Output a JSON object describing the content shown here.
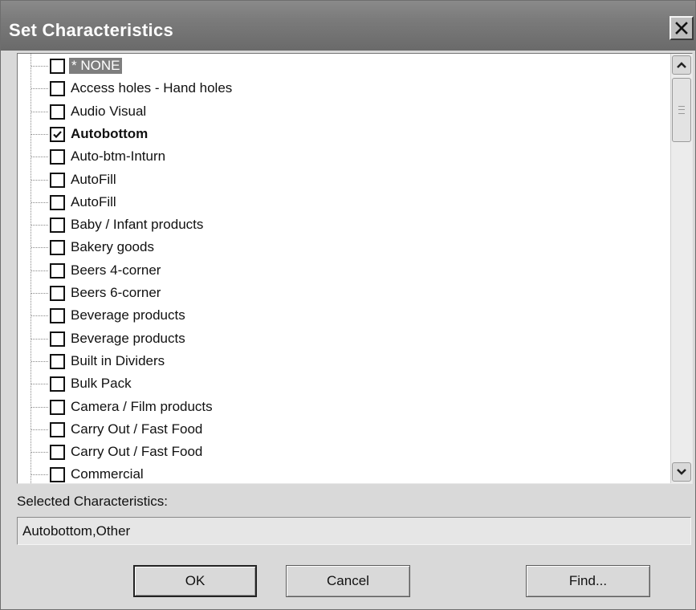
{
  "window": {
    "title": "Set Characteristics"
  },
  "list": {
    "items": [
      {
        "label": "* NONE",
        "checked": false,
        "selected": true
      },
      {
        "label": "Access holes - Hand holes",
        "checked": false
      },
      {
        "label": "Audio Visual",
        "checked": false
      },
      {
        "label": "Autobottom",
        "checked": true,
        "bold": true
      },
      {
        "label": "Auto-btm-Inturn",
        "checked": false
      },
      {
        "label": "AutoFill",
        "checked": false
      },
      {
        "label": "AutoFill",
        "checked": false
      },
      {
        "label": "Baby / Infant products",
        "checked": false
      },
      {
        "label": "Bakery goods",
        "checked": false
      },
      {
        "label": "Beers 4-corner",
        "checked": false
      },
      {
        "label": "Beers 6-corner",
        "checked": false
      },
      {
        "label": "Beverage products",
        "checked": false
      },
      {
        "label": "Beverage products",
        "checked": false
      },
      {
        "label": "Built in Dividers",
        "checked": false
      },
      {
        "label": "Bulk Pack",
        "checked": false
      },
      {
        "label": "Camera / Film products",
        "checked": false
      },
      {
        "label": "Carry Out / Fast Food",
        "checked": false
      },
      {
        "label": "Carry Out / Fast Food",
        "checked": false
      },
      {
        "label": "Commercial",
        "checked": false
      }
    ]
  },
  "selected": {
    "label": "Selected Characteristics:",
    "value": "Autobottom,Other"
  },
  "buttons": {
    "ok": "OK",
    "cancel": "Cancel",
    "find": "Find..."
  },
  "colors": {
    "titlebar": "#7a7a7a",
    "selection": "#7e7e7e"
  }
}
